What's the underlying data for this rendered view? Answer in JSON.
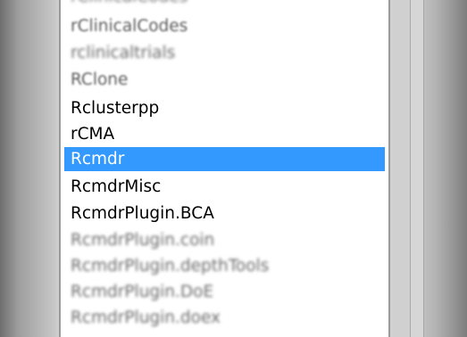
{
  "listbox": {
    "items": [
      {
        "label": "rClinicalCodes",
        "state": "dim"
      },
      {
        "label": "rClinicalCodes",
        "state": "dim"
      },
      {
        "label": "rclinicaltrials",
        "state": "dim2"
      },
      {
        "label": "RClone",
        "state": "dim"
      },
      {
        "label": "Rclusterpp",
        "state": "normal"
      },
      {
        "label": "rCMA",
        "state": "normal"
      },
      {
        "label": "Rcmdr",
        "state": "selected"
      },
      {
        "label": "RcmdrMisc",
        "state": "normal"
      },
      {
        "label": "RcmdrPlugin.BCA",
        "state": "normal"
      },
      {
        "label": "RcmdrPlugin.coin",
        "state": "dim2"
      },
      {
        "label": "RcmdrPlugin.depthTools",
        "state": "dim2"
      },
      {
        "label": "RcmdrPlugin.DoE",
        "state": "dim2"
      },
      {
        "label": "RcmdrPlugin.doex",
        "state": "dim2"
      }
    ],
    "selected_color": "#3399ff"
  }
}
